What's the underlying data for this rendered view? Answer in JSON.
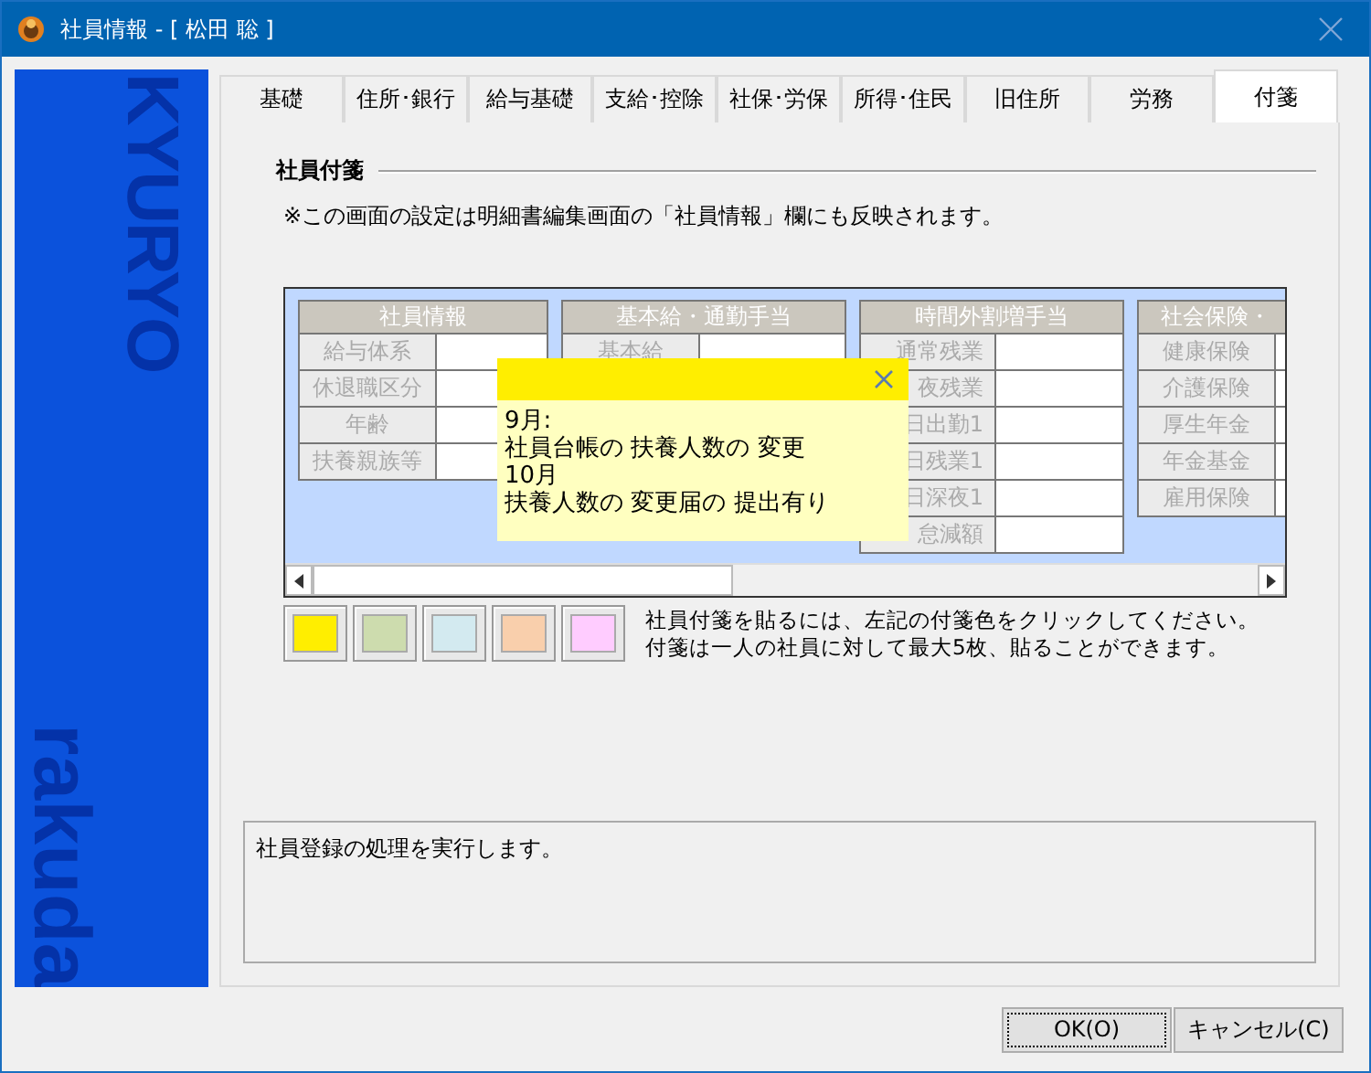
{
  "window": {
    "title": "社員情報 - [ 松田 聡 ]"
  },
  "sidebar": {
    "brand_top": "KYURYO",
    "brand_bottom": "rakuda"
  },
  "tabs": [
    {
      "label": "基礎",
      "selected": false
    },
    {
      "label": "住所･銀行",
      "selected": false
    },
    {
      "label": "給与基礎",
      "selected": false
    },
    {
      "label": "支給･控除",
      "selected": false
    },
    {
      "label": "社保･労保",
      "selected": false
    },
    {
      "label": "所得･住民",
      "selected": false
    },
    {
      "label": "旧住所",
      "selected": false
    },
    {
      "label": "労務",
      "selected": false
    },
    {
      "label": "付箋",
      "selected": true
    }
  ],
  "section": {
    "title": "社員付箋",
    "notice": "※この画面の設定は明細書編集画面の「社員情報」欄にも反映されます。"
  },
  "preview": {
    "groups": [
      {
        "header": "社員情報",
        "rows": [
          "給与体系",
          "休退職区分",
          "年齢",
          "扶養親族等"
        ]
      },
      {
        "header": "基本給・通勤手当",
        "rows": [
          "基本給"
        ]
      },
      {
        "header": "時間外割増手当",
        "rows": [
          "通常残業",
          "夜残業",
          "日出勤1",
          "日残業1",
          "日深夜1",
          "怠減額"
        ]
      },
      {
        "header": "社会保険・",
        "rows": [
          "健康保険",
          "介護保険",
          "厚生年金",
          "年金基金",
          "雇用保険"
        ]
      }
    ],
    "note": {
      "lines": [
        "9月:",
        "社員台帳の 扶養人数の 変更",
        "10月",
        "扶養人数の 変更届の 提出有り"
      ]
    }
  },
  "swatches": [
    {
      "color": "#ffee00"
    },
    {
      "color": "#cddcae"
    },
    {
      "color": "#d3eaf0"
    },
    {
      "color": "#f9cfac"
    },
    {
      "color": "#ffccff"
    }
  ],
  "swatch_help": [
    "社員付箋を貼るには、左記の付箋色をクリックしてください。",
    "付箋は一人の社員に対して最大5枚、貼ることができます。"
  ],
  "message": "社員登録の処理を実行します。",
  "buttons": [
    "OK(O)",
    "キャンセル(C)"
  ]
}
